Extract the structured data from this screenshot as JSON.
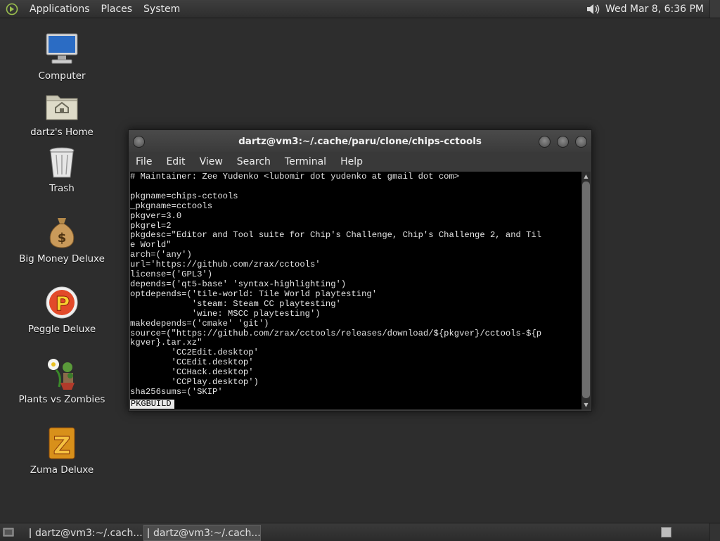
{
  "top_panel": {
    "menus": [
      "Applications",
      "Places",
      "System"
    ],
    "clock": "Wed Mar  8,  6:36 PM"
  },
  "desktop_icons": [
    {
      "label": "Computer",
      "icon": "computer-icon"
    },
    {
      "label": "dartz's Home",
      "icon": "home-folder-icon"
    },
    {
      "label": "Trash",
      "icon": "trash-icon"
    },
    {
      "label": "Big Money Deluxe",
      "icon": "money-bag-icon"
    },
    {
      "label": "Peggle Deluxe",
      "icon": "peggle-icon"
    },
    {
      "label": "Plants vs Zombies",
      "icon": "plants-vs-zombies-icon"
    },
    {
      "label": "Zuma Deluxe",
      "icon": "zuma-icon"
    }
  ],
  "terminal": {
    "title": "dartz@vm3:~/.cache/paru/clone/chips-cctools",
    "menu": [
      "File",
      "Edit",
      "View",
      "Search",
      "Terminal",
      "Help"
    ],
    "lines": [
      "# Maintainer: Zee Yudenko <lubomir dot yudenko at gmail dot com>",
      "",
      "pkgname=chips-cctools",
      "_pkgname=cctools",
      "pkgver=3.0",
      "pkgrel=2",
      "pkgdesc=\"Editor and Tool suite for Chip's Challenge, Chip's Challenge 2, and Til",
      "e World\"",
      "arch=('any')",
      "url='https://github.com/zrax/cctools'",
      "license=('GPL3')",
      "depends=('qt5-base' 'syntax-highlighting')",
      "optdepends=('tile-world: Tile World playtesting'",
      "            'steam: Steam CC playtesting'",
      "            'wine: MSCC playtesting')",
      "makedepends=('cmake' 'git')",
      "source=(\"https://github.com/zrax/cctools/releases/download/${pkgver}/cctools-${p",
      "kgver}.tar.xz\"",
      "        'CC2Edit.desktop'",
      "        'CCEdit.desktop'",
      "        'CCHack.desktop'",
      "        'CCPlay.desktop')",
      "sha256sums=('SKIP'"
    ],
    "status": "PKGBUILD"
  },
  "taskbar": {
    "tasks": [
      {
        "label": "dartz@vm3:~/.cach...",
        "active": false
      },
      {
        "label": "dartz@vm3:~/.cach...",
        "active": true
      }
    ]
  }
}
